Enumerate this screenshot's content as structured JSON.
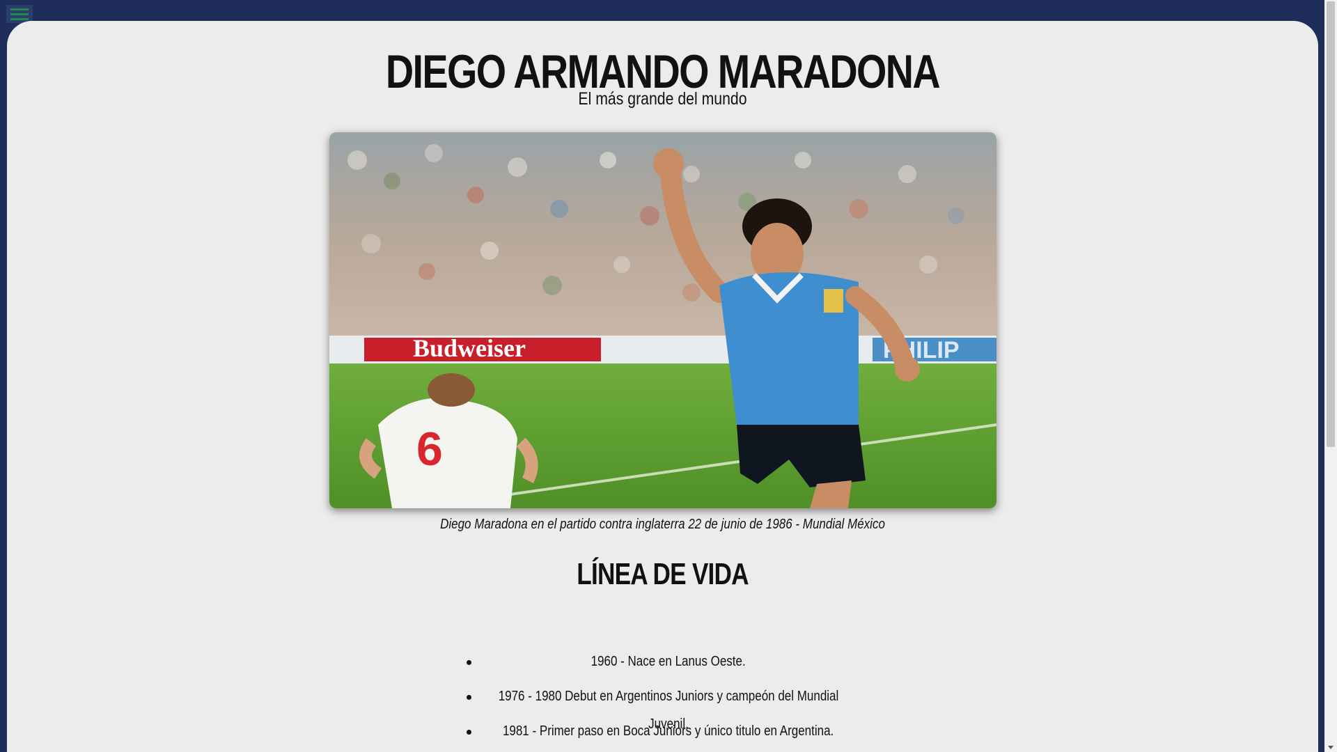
{
  "header": {
    "title": "DIEGO ARMANDO MARADONA",
    "subtitle": "El más grande del mundo"
  },
  "hero_image": {
    "alt": "Diego Maradona celebrando con la camiseta de Argentina",
    "banner_text_left": "Budweiser",
    "banner_text_right": "PHILIP",
    "jersey_number": "6",
    "caption": "Diego Maradona en el partido contra inglaterra 22 de junio de 1986 - Mundial México"
  },
  "timeline": {
    "title": "LÍNEA DE VIDA",
    "items": [
      "1960 - Nace en Lanus Oeste.",
      "1976 - 1980 Debut en Argentinos Juniors y campeón del Mundial Juvenil.",
      "1981 - Primer paso en Boca Juniors y único titulo en Argentina."
    ]
  },
  "colors": {
    "background_frame": "#1f2d5a",
    "page_background": "#ececec",
    "menu_icon": "#1f8a4c"
  },
  "icons": {
    "menu": "hamburger-icon"
  }
}
